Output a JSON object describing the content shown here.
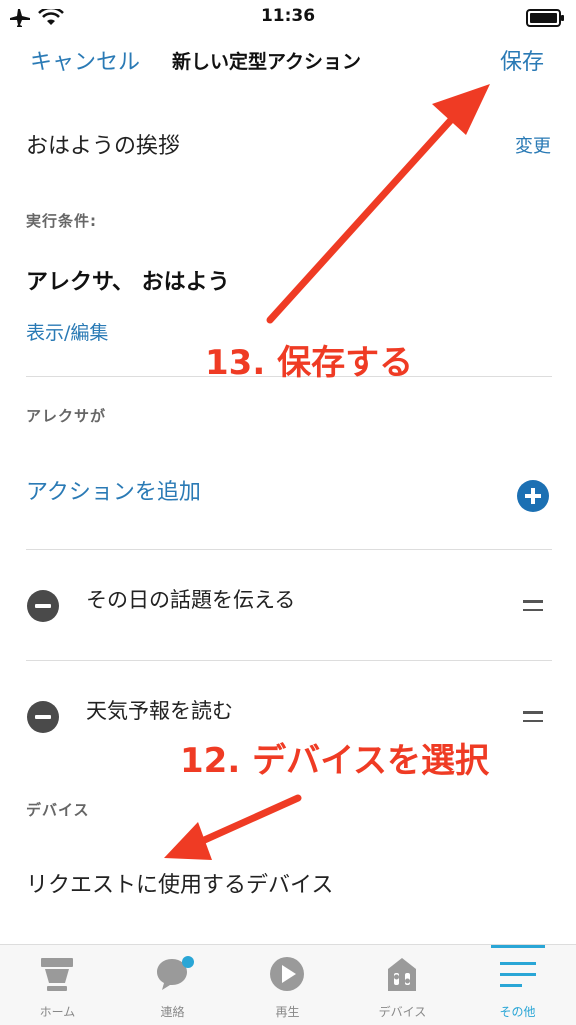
{
  "status": {
    "time": "11:36"
  },
  "nav": {
    "cancel": "キャンセル",
    "title": "新しい定型アクション",
    "save": "保存"
  },
  "routine": {
    "name": "おはようの挨拶",
    "change": "変更"
  },
  "trigger": {
    "label": "実行条件:",
    "phrase": "アレクサ、 おはよう",
    "edit": "表示/編集"
  },
  "actions": {
    "label": "アレクサが",
    "add": "アクションを追加",
    "items": [
      {
        "label": "その日の話題を伝える"
      },
      {
        "label": "天気予報を読む"
      }
    ]
  },
  "device": {
    "label": "デバイス",
    "value": "リクエストに使用するデバイス"
  },
  "annotations": {
    "step13": "13. 保存する",
    "step12": "12. デバイスを選択"
  },
  "colors": {
    "accent": "#2a7ab5",
    "annotation": "#ef3b24",
    "active_tab": "#2aa6d6"
  },
  "tabs": [
    {
      "label": "ホーム",
      "icon": "home-icon"
    },
    {
      "label": "連絡",
      "icon": "chat-icon"
    },
    {
      "label": "再生",
      "icon": "play-icon"
    },
    {
      "label": "デバイス",
      "icon": "devices-icon"
    },
    {
      "label": "その他",
      "icon": "menu-icon",
      "active": true
    }
  ]
}
